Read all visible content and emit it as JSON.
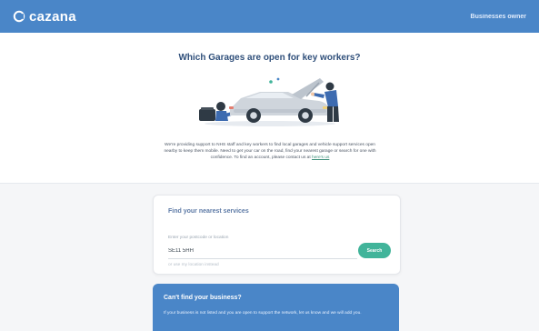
{
  "header": {
    "brand": "cazana",
    "right_link": "Businesses owner"
  },
  "hero": {
    "title": "Which Garages are open for key workers?",
    "description": "We're providing support to NHS staff and key workers to find local garages and vehicle support services open nearby to keep them mobile. Need to get your car on the road, find your nearest garage or search for one with confidence. To find an account, please contact us at ",
    "link_text": "here's us"
  },
  "search_card": {
    "title": "Find your nearest services",
    "field_label": "Enter your postcode or location",
    "input_value": "SE11 5HH",
    "button_label": "Search",
    "hint": "or use my location instead"
  },
  "panel": {
    "title": "Can't find your business?",
    "text": "If your business is not listed and you are open to support the network, let us know and we will add you."
  },
  "colors": {
    "topbar": "#4a86c8",
    "accent": "#41b49a",
    "title": "#2f4f7a"
  }
}
